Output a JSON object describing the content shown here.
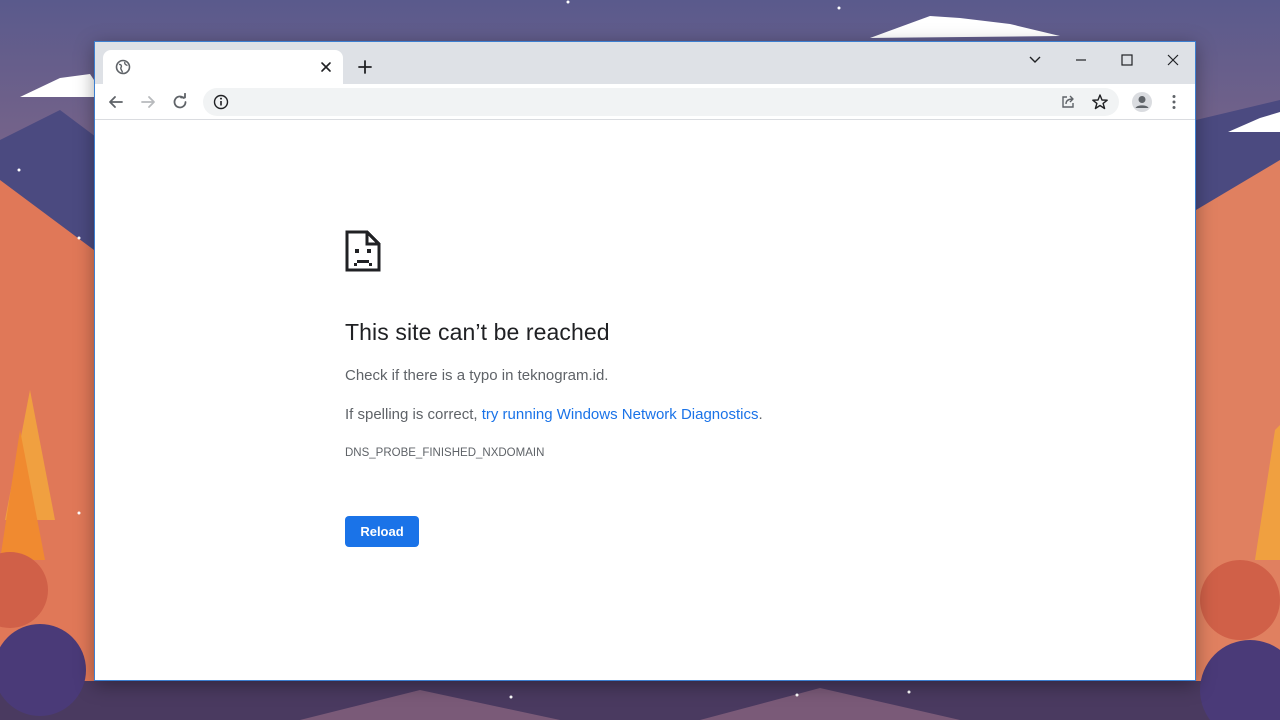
{
  "tab": {
    "title": "",
    "favicon": "globe-icon",
    "close_icon": "close-icon"
  },
  "tabstrip": {
    "new_tab_icon": "plus-icon",
    "search_tabs_icon": "chevron-down-icon"
  },
  "window_controls": [
    "minimize-icon",
    "maximize-icon",
    "close-icon"
  ],
  "toolbar": {
    "back_icon": "arrow-left-icon",
    "forward_icon": "arrow-right-icon",
    "reload_icon": "reload-icon",
    "site_info_icon": "info-icon",
    "share_icon": "share-icon",
    "bookmark_icon": "star-icon",
    "profile_icon": "avatar-icon",
    "menu_icon": "kebab-menu-icon"
  },
  "omnibox": {
    "value": ""
  },
  "error": {
    "icon": "sad-page-icon",
    "title": "This site can’t be reached",
    "line1": "Check if there is a typo in teknogram.id.",
    "line2_prefix": "If spelling is correct, ",
    "line2_link": "try running Windows Network Diagnostics",
    "line2_suffix": ".",
    "code": "DNS_PROBE_FINISHED_NXDOMAIN",
    "reload_label": "Reload"
  },
  "colors": {
    "accent": "#1a73e8",
    "tabstrip_bg": "#dee1e6",
    "omnibox_bg": "#f1f3f4",
    "title_text": "#202124",
    "body_text": "#5f6368"
  }
}
